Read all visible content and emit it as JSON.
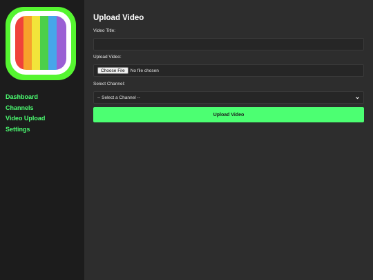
{
  "sidebar": {
    "logo_icon": "tv-color-bars-icon",
    "accent_color": "#4cff72",
    "nav": [
      {
        "label": "Dashboard"
      },
      {
        "label": "Channels"
      },
      {
        "label": "Video Upload"
      },
      {
        "label": "Settings"
      }
    ]
  },
  "form": {
    "title": "Upload Video",
    "video_title_label": "Video Title:",
    "video_title_value": "",
    "upload_label": "Upload Video:",
    "file_button_label": "Choose File",
    "file_status": "No file chosen",
    "channel_label": "Select Channel:",
    "channel_selected": "-- Select a Channel --",
    "submit_label": "Upload Video"
  }
}
